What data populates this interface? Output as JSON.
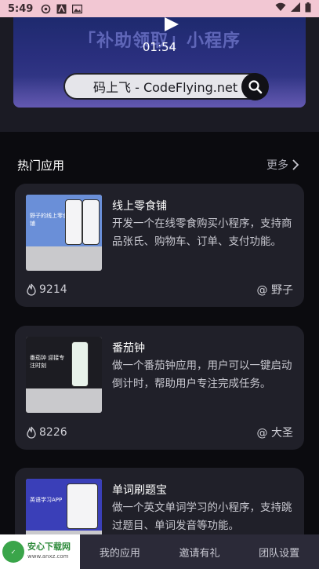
{
  "status_bar": {
    "time": "5:49"
  },
  "video": {
    "banner_text": "「补助领取」小程序",
    "duration": "01:54",
    "search_text": "码上飞 - CodeFlying.net"
  },
  "section": {
    "title": "热门应用",
    "more_label": "更多"
  },
  "apps": [
    {
      "name": "线上零食铺",
      "description": "开发一个在线零食购买小程序，支持商品张氏、购物车、订单、支付功能。",
      "views": "9214",
      "author": "@ 野子",
      "thumb_caption": "野子的线上零食铺",
      "thumb_color": "#6a8fd8"
    },
    {
      "name": "番茄钟",
      "description": "做一个番茄钟应用，用户可以一键启动倒计时，帮助用户专注完成任务。",
      "views": "8226",
      "author": "@ 大圣",
      "thumb_caption": "番茄钟 迎接专注时刻",
      "thumb_color": "#1c1c22"
    },
    {
      "name": "单词刷题宝",
      "description": "做一个英文单词学习的小程序，支持跳过题目、单词发音等功能。",
      "thumb_caption": "英语学习APP",
      "thumb_color": "#3a3fb8"
    }
  ],
  "bottom_nav": {
    "logo_brand": "安心下载网",
    "logo_url": "www.anxz.com",
    "items": [
      "我的应用",
      "邀请有礼",
      "团队设置"
    ]
  },
  "colors": {
    "background": "#0b0b0f",
    "card": "#202029",
    "status_bar": "#f2c7d3",
    "nav": "#2b2a38"
  }
}
